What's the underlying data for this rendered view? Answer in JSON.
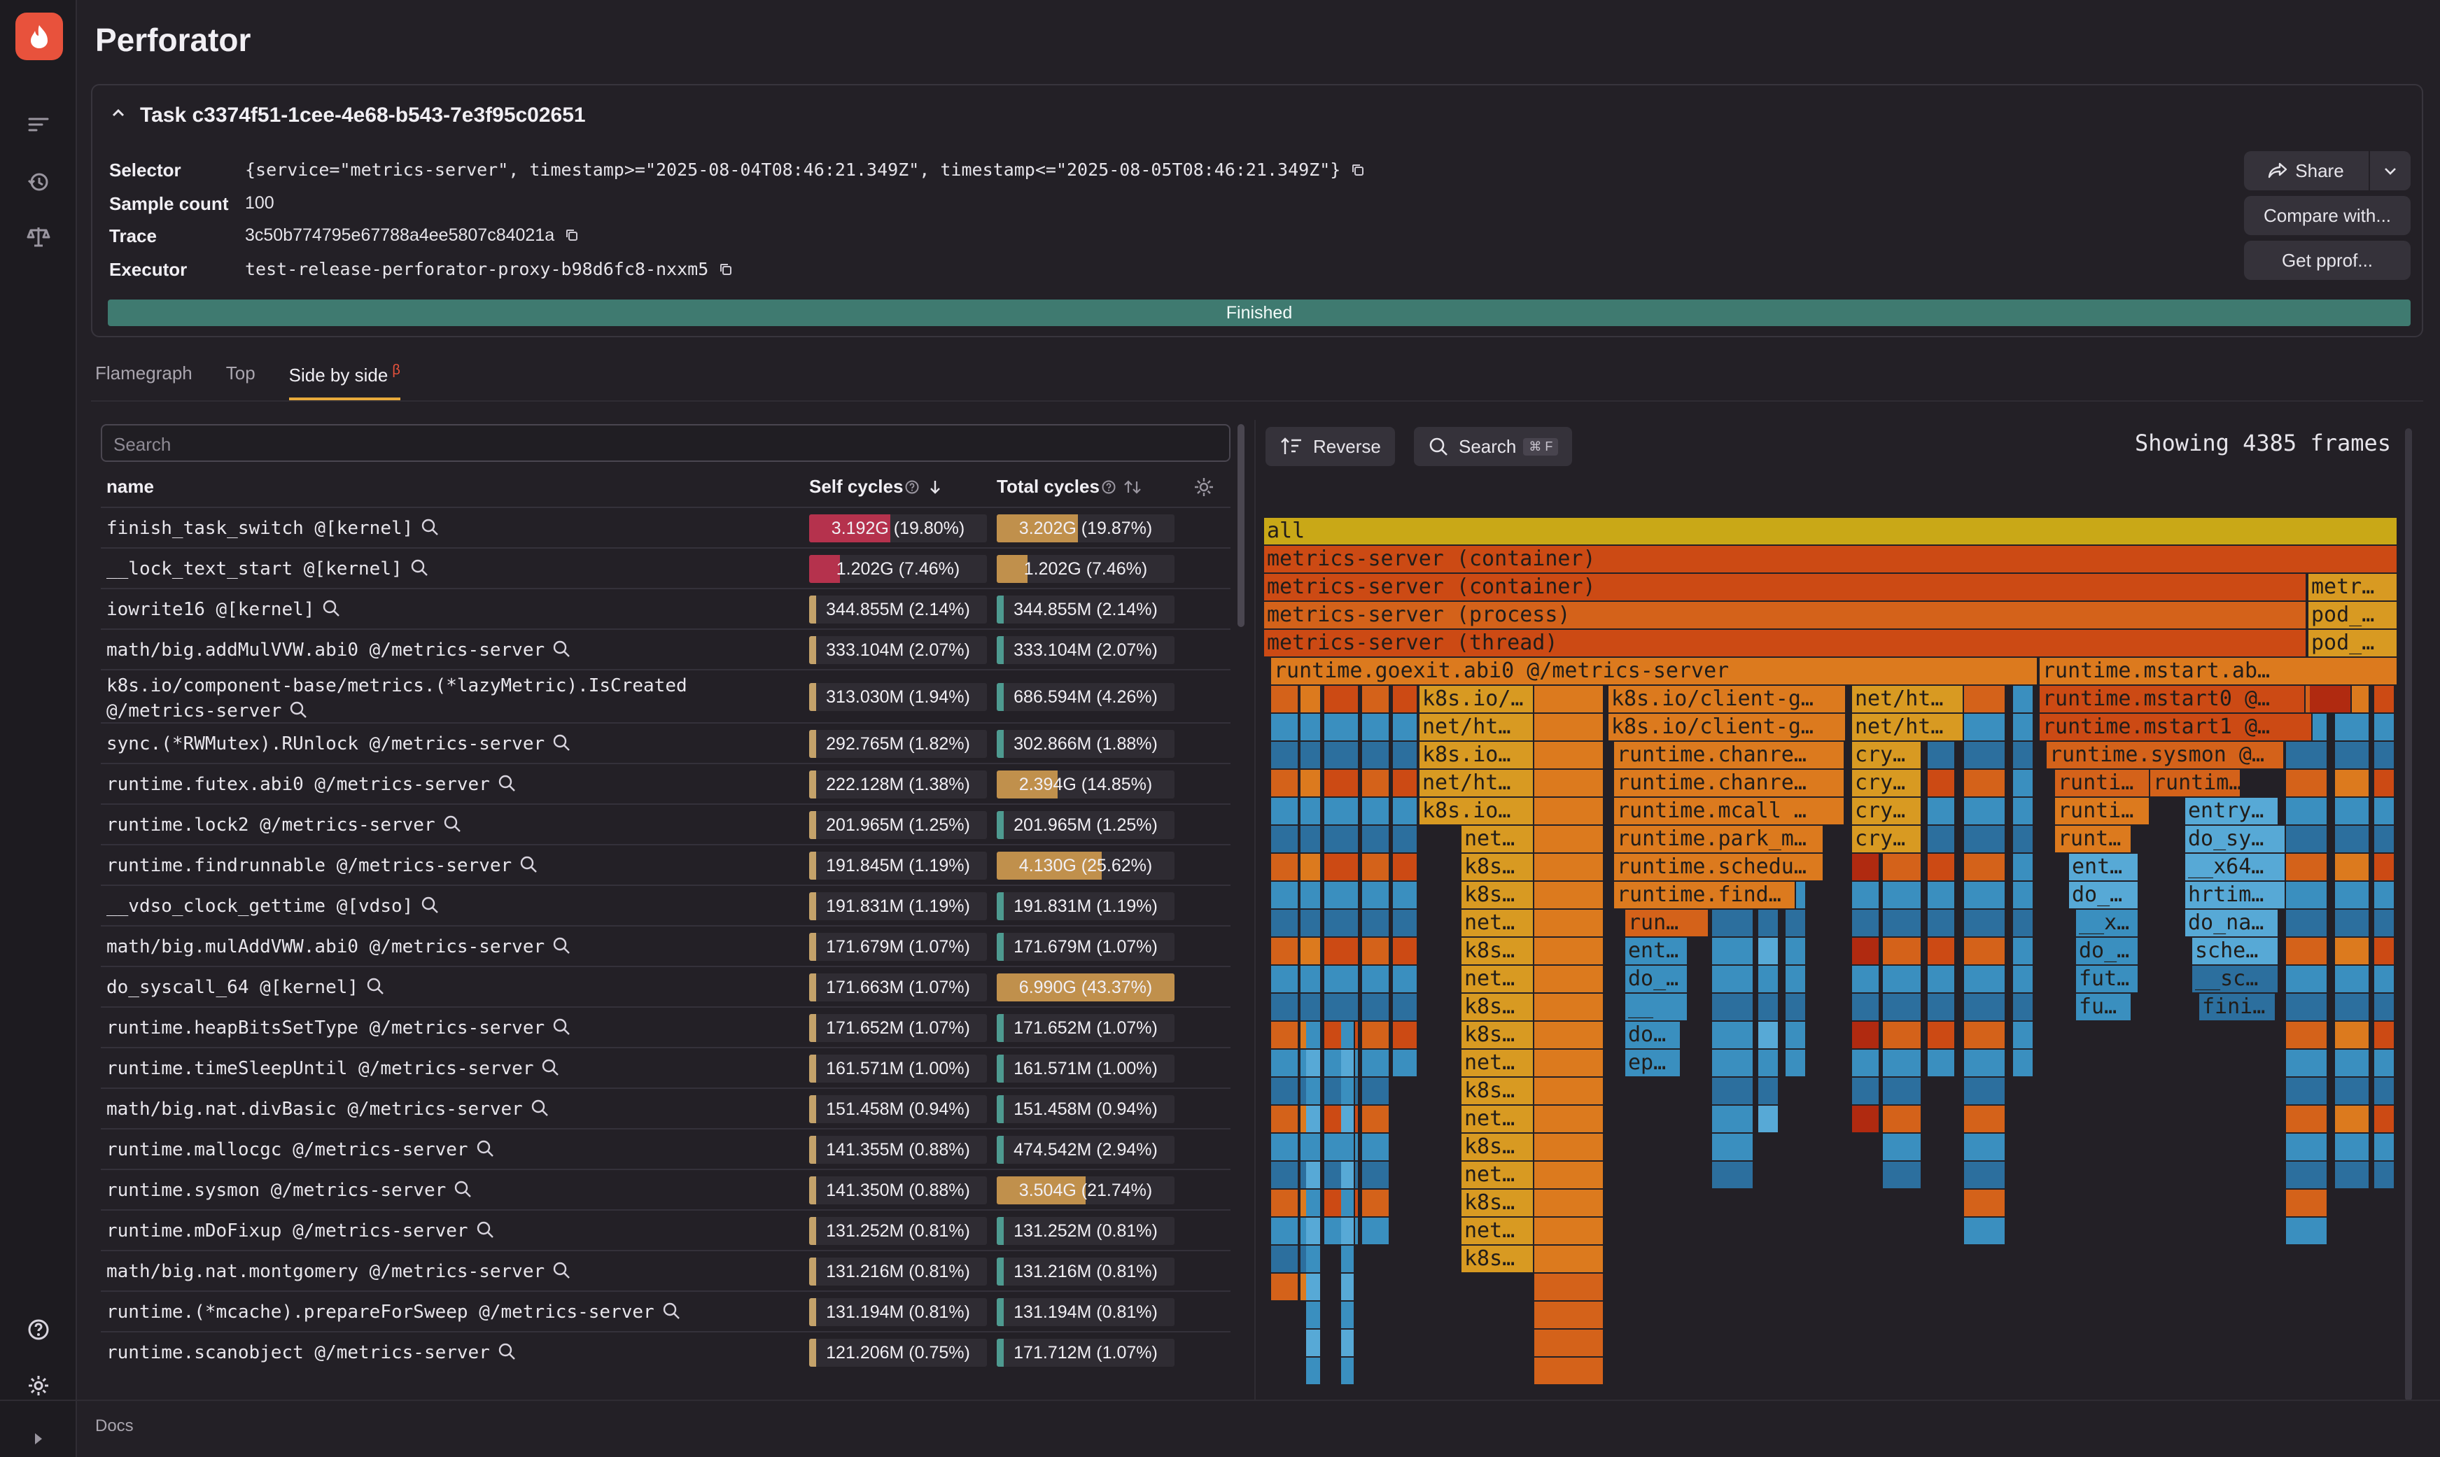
{
  "app": {
    "title": "Perforator"
  },
  "task": {
    "title": "Task c3374f51-1cee-4e68-b543-7e3f95c02651",
    "selector_label": "Selector",
    "selector": "{service=\"metrics-server\", timestamp>=\"2025-08-04T08:46:21.349Z\", timestamp<=\"2025-08-05T08:46:21.349Z\"}",
    "sample_count_label": "Sample count",
    "sample_count": "100",
    "trace_label": "Trace",
    "trace": "3c50b774795e67788a4ee5807c84021a",
    "executor_label": "Executor",
    "executor": "test-release-perforator-proxy-b98d6fc8-nxxm5",
    "status": "Finished",
    "progress": 1.0,
    "share_label": "Share",
    "compare_label": "Compare with...",
    "pprof_label": "Get pprof..."
  },
  "tabs": [
    {
      "label": "Flamegraph",
      "active": false
    },
    {
      "label": "Top",
      "active": false
    },
    {
      "label": "Side by side",
      "active": true,
      "badge": "β"
    }
  ],
  "table": {
    "search_placeholder": "Search",
    "col_name": "name",
    "col_self": "Self cycles",
    "col_total": "Total cycles",
    "rows": [
      {
        "name": "finish_task_switch @[kernel]",
        "self": "3.192G (19.80%)",
        "self_frac": 0.198,
        "total": "3.202G (19.87%)",
        "total_frac": 0.1987
      },
      {
        "name": "__lock_text_start @[kernel]",
        "self": "1.202G (7.46%)",
        "self_frac": 0.0746,
        "total": "1.202G (7.46%)",
        "total_frac": 0.0746
      },
      {
        "name": "iowrite16 @[kernel]",
        "self": "344.855M (2.14%)",
        "self_frac": 0.0214,
        "total": "344.855M (2.14%)",
        "total_frac": 0.0214
      },
      {
        "name": "math/big.addMulVVW.abi0 @/metrics-server",
        "self": "333.104M (2.07%)",
        "self_frac": 0.0207,
        "total": "333.104M (2.07%)",
        "total_frac": 0.0207
      },
      {
        "name": "k8s.io/component-base/metrics.(*lazyMetric).IsCreated @/metrics-server",
        "self": "313.030M (1.94%)",
        "self_frac": 0.0194,
        "total": "686.594M (4.26%)",
        "total_frac": 0.0426,
        "tall": true
      },
      {
        "name": "sync.(*RWMutex).RUnlock @/metrics-server",
        "self": "292.765M (1.82%)",
        "self_frac": 0.0182,
        "total": "302.866M (1.88%)",
        "total_frac": 0.0188
      },
      {
        "name": "runtime.futex.abi0 @/metrics-server",
        "self": "222.128M (1.38%)",
        "self_frac": 0.0138,
        "total": "2.394G (14.85%)",
        "total_frac": 0.1485
      },
      {
        "name": "runtime.lock2 @/metrics-server",
        "self": "201.965M (1.25%)",
        "self_frac": 0.0125,
        "total": "201.965M (1.25%)",
        "total_frac": 0.0125
      },
      {
        "name": "runtime.findrunnable @/metrics-server",
        "self": "191.845M (1.19%)",
        "self_frac": 0.0119,
        "total": "4.130G (25.62%)",
        "total_frac": 0.2562
      },
      {
        "name": "__vdso_clock_gettime @[vdso]",
        "self": "191.831M (1.19%)",
        "self_frac": 0.0119,
        "total": "191.831M (1.19%)",
        "total_frac": 0.0119
      },
      {
        "name": "math/big.mulAddVWW.abi0 @/metrics-server",
        "self": "171.679M (1.07%)",
        "self_frac": 0.0107,
        "total": "171.679M (1.07%)",
        "total_frac": 0.0107
      },
      {
        "name": "do_syscall_64 @[kernel]",
        "self": "171.663M (1.07%)",
        "self_frac": 0.0107,
        "total": "6.990G (43.37%)",
        "total_frac": 0.4337
      },
      {
        "name": "runtime.heapBitsSetType @/metrics-server",
        "self": "171.652M (1.07%)",
        "self_frac": 0.0107,
        "total": "171.652M (1.07%)",
        "total_frac": 0.0107
      },
      {
        "name": "runtime.timeSleepUntil @/metrics-server",
        "self": "161.571M (1.00%)",
        "self_frac": 0.01,
        "total": "161.571M (1.00%)",
        "total_frac": 0.01
      },
      {
        "name": "math/big.nat.divBasic @/metrics-server",
        "self": "151.458M (0.94%)",
        "self_frac": 0.0094,
        "total": "151.458M (0.94%)",
        "total_frac": 0.0094
      },
      {
        "name": "runtime.mallocgc @/metrics-server",
        "self": "141.355M (0.88%)",
        "self_frac": 0.0088,
        "total": "474.542M (2.94%)",
        "total_frac": 0.0294
      },
      {
        "name": "runtime.sysmon @/metrics-server",
        "self": "141.350M (0.88%)",
        "self_frac": 0.0088,
        "total": "3.504G (21.74%)",
        "total_frac": 0.2174
      },
      {
        "name": "runtime.mDoFixup @/metrics-server",
        "self": "131.252M (0.81%)",
        "self_frac": 0.0081,
        "total": "131.252M (0.81%)",
        "total_frac": 0.0081
      },
      {
        "name": "math/big.nat.montgomery @/metrics-server",
        "self": "131.216M (0.81%)",
        "self_frac": 0.0081,
        "total": "131.216M (0.81%)",
        "total_frac": 0.0081
      },
      {
        "name": "runtime.(*mcache).prepareForSweep @/metrics-server",
        "self": "131.194M (0.81%)",
        "self_frac": 0.0081,
        "total": "131.194M (0.81%)",
        "total_frac": 0.0081
      },
      {
        "name": "runtime.scanobject @/metrics-server",
        "self": "121.206M (0.75%)",
        "self_frac": 0.0075,
        "total": "171.712M (1.07%)",
        "total_frac": 0.0107
      }
    ]
  },
  "flamegraph": {
    "reverse_label": "Reverse",
    "search_label": "Search",
    "search_kbd": "⌘ F",
    "frames_text": "Showing 4385 frames",
    "frames": [
      "all",
      "metrics-server (container)",
      "metrics-server (container)",
      "metr…",
      "metrics-server (process)",
      "pod_…",
      "metrics-server (thread)",
      "pod_…",
      "runtime.goexit.abi0 @/metrics-server",
      "runtime.mstart.ab…",
      "k8s.io/…",
      "k8s.io/client-g…",
      "net/ht…",
      "runtime.mstart0 @…",
      "net/ht…",
      "k8s.io/client-g…",
      "net/ht…",
      "runtime.mstart1 @…",
      "k8s.io…",
      "runtime.chanre…",
      "cry…",
      "runtime.sysmon @…",
      "net/ht…",
      "runtime.chanre…",
      "cry…",
      "runti…",
      "runtim…",
      "k8s.io…",
      "runtime.mcall …",
      "cry…",
      "runti…",
      "entry…",
      "net…",
      "runtime.park_m…",
      "cry…",
      "runt…",
      "do_sy…",
      "k8s…",
      "runtime.schedu…",
      "ent…",
      "__x64…",
      "k8s…",
      "runtime.find…",
      "do_…",
      "hrtim…",
      "net…",
      "run…",
      "__x…",
      "do_na…",
      "k8s…",
      "ent…",
      "do_…",
      "sche…",
      "net…",
      "do_…",
      "fut…",
      "__sc…",
      "k8s…",
      "__",
      "fu…",
      "fini…",
      "k8s…",
      "do…",
      "net…",
      "ep…",
      "k8s…",
      "net…",
      "k8s…",
      "net…",
      "k8s…",
      "net…",
      "k8s…"
    ]
  },
  "footer": {
    "docs": "Docs"
  },
  "colors": {
    "accent": "#e8523c",
    "status": "#3f7a70",
    "tab_underline": "#e8aa3c"
  }
}
